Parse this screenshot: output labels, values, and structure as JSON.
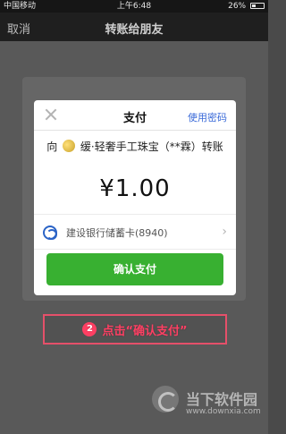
{
  "status_bar": {
    "carrier": "中国移动",
    "time": "上午6:48",
    "battery_text": "26%"
  },
  "nav": {
    "cancel": "取消",
    "title": "转账给朋友"
  },
  "modal": {
    "title": "支付",
    "password_link": "使用密码",
    "recipient_prefix": "向",
    "recipient_name": "缓·轻奢手工珠宝（**霖）转账",
    "amount": "¥1.00",
    "card": "建设银行储蓄卡(8940)",
    "confirm": "确认支付"
  },
  "instruction": {
    "step": "2",
    "text": "点击“确认支付”"
  },
  "watermark": {
    "name": "当下软件园",
    "url": "www.downxia.com"
  },
  "colors": {
    "confirm_green": "#38b031",
    "link_blue": "#3a6ad8",
    "instruction_red": "#ff3f63"
  }
}
